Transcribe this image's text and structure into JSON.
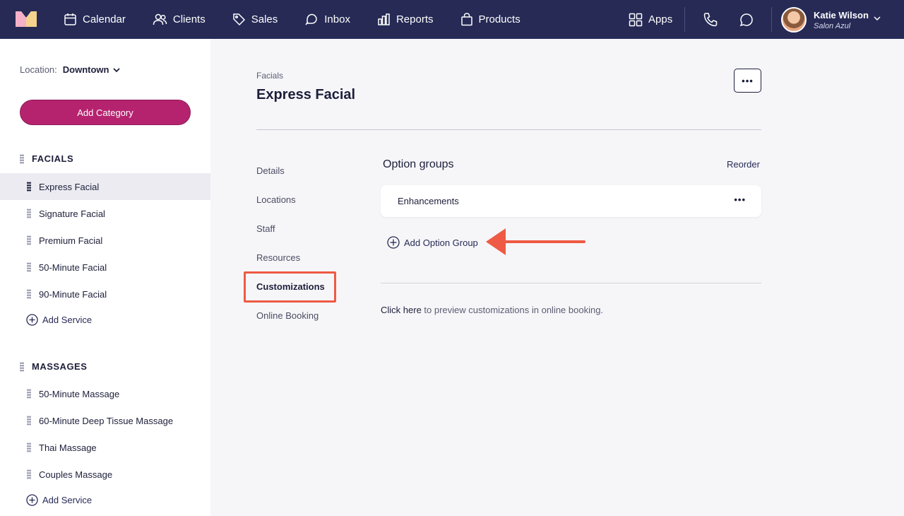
{
  "nav": {
    "items": [
      {
        "label": "Calendar",
        "icon": "calendar-icon"
      },
      {
        "label": "Clients",
        "icon": "clients-icon"
      },
      {
        "label": "Sales",
        "icon": "tag-icon"
      },
      {
        "label": "Inbox",
        "icon": "inbox-icon"
      },
      {
        "label": "Reports",
        "icon": "reports-icon"
      },
      {
        "label": "Products",
        "icon": "bag-icon"
      }
    ],
    "apps_label": "Apps",
    "user": {
      "name": "Katie Wilson",
      "salon": "Salon Azul"
    }
  },
  "sidebar": {
    "location_label": "Location:",
    "location_value": "Downtown",
    "add_category_label": "Add Category",
    "categories": [
      {
        "name": "FACIALS",
        "services": [
          "Express Facial",
          "Signature Facial",
          "Premium Facial",
          "50-Minute Facial",
          "90-Minute Facial"
        ],
        "add_label": "Add Service"
      },
      {
        "name": "MASSAGES",
        "services": [
          "50-Minute Massage",
          "60-Minute Deep Tissue Massage",
          "Thai Massage",
          "Couples Massage"
        ],
        "add_label": "Add Service"
      }
    ]
  },
  "main": {
    "breadcrumb": "Facials",
    "title": "Express Facial",
    "more_label": "•••",
    "tabs": [
      "Details",
      "Locations",
      "Staff",
      "Resources",
      "Customizations",
      "Online Booking"
    ],
    "active_tab": "Customizations",
    "option_groups_title": "Option groups",
    "reorder_label": "Reorder",
    "option_groups": [
      {
        "label": "Enhancements"
      }
    ],
    "card_more_label": "•••",
    "add_option_group_label": "Add Option Group",
    "preview_link": "Click here",
    "preview_text": " to preview customizations in online booking."
  },
  "colors": {
    "topbar": "#262a55",
    "accent": "#b5236f",
    "annotation": "#ef5a44"
  }
}
